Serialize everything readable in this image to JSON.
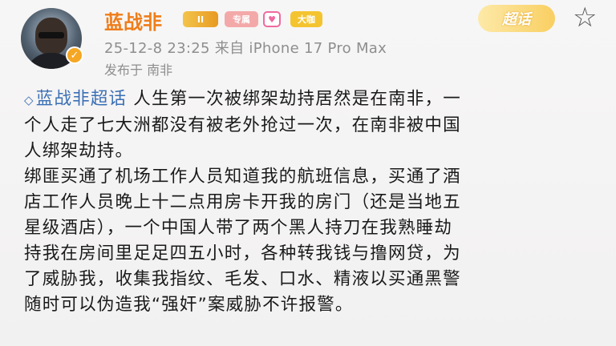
{
  "user": {
    "name": "蓝战非",
    "level_badge": "II",
    "badges": [
      "专属",
      "大咖"
    ],
    "gem_badge": "♥",
    "verify_mark": "✓"
  },
  "chaohua_button": "超话",
  "meta": {
    "time_device": "25-12-8 23:25   来自 iPhone 17 Pro Max",
    "location": "发布于 南非"
  },
  "post": {
    "topic": "蓝战非超话",
    "lines": [
      " 人生第一次被绑架劫持居然是在南非，一",
      "个人走了七大洲都没有被老外抢过一次，在南非被中国",
      "人绑架劫持。",
      "绑匪买通了机场工作人员知道我的航班信息，买通了酒",
      "店工作人员晚上十二点用房卡开我的房门（还是当地五",
      "星级酒店），一个中国人带了两个黑人持刀在我熟睡劫",
      "持我在房间里足足四五小时，各种转我钱与撸网贷，为",
      "了威胁我，收集我指纹、毛发、口水、精液以买通黑警",
      "随时可以伪造我“强奸”案威胁不许报警。"
    ]
  },
  "colors": {
    "name": "#ef7d1a",
    "topic": "#3a6fb5",
    "meta": "#8e8e8e"
  }
}
